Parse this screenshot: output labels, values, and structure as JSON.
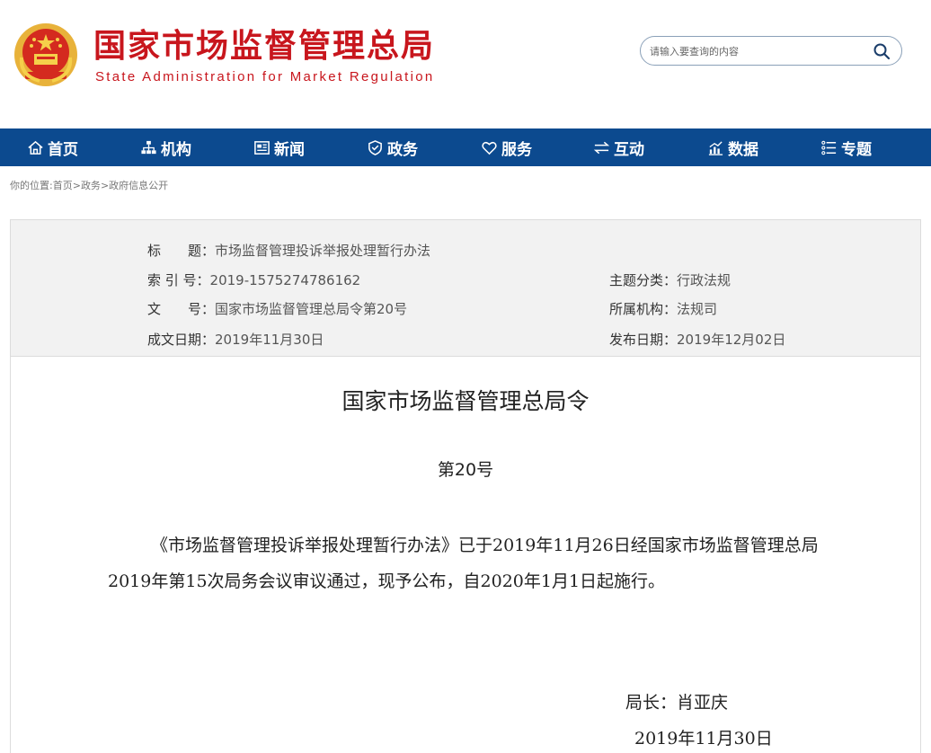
{
  "header": {
    "title_cn": "国家市场监督管理总局",
    "title_en": "State Administration for Market Regulation",
    "search_placeholder": "请输入要查询的内容"
  },
  "nav": {
    "items": [
      {
        "label": "首页",
        "icon": "home-icon"
      },
      {
        "label": "机构",
        "icon": "org-chart-icon"
      },
      {
        "label": "新闻",
        "icon": "newspaper-icon"
      },
      {
        "label": "政务",
        "icon": "shield-icon"
      },
      {
        "label": "服务",
        "icon": "heart-icon"
      },
      {
        "label": "互动",
        "icon": "exchange-icon"
      },
      {
        "label": "数据",
        "icon": "bar-chart-icon"
      },
      {
        "label": "专题",
        "icon": "list-icon"
      }
    ]
  },
  "breadcrumb": {
    "prefix": "你的位置:",
    "items": [
      "首页",
      "政务",
      "政府信息公开"
    ],
    "separator": ">"
  },
  "meta": {
    "title_label": "标　　题：",
    "title_value": "市场监督管理投诉举报处理暂行办法",
    "index_label": "索 引 号：",
    "index_value": "2019-1575274786162",
    "topic_label": "主题分类：",
    "topic_value": "行政法规",
    "docno_label": "文　　号：",
    "docno_value": "国家市场监督管理总局令第20号",
    "org_label": "所属机构：",
    "org_value": "法规司",
    "made_label": "成文日期：",
    "made_value": "2019年11月30日",
    "pub_label": "发布日期：",
    "pub_value": "2019年12月02日"
  },
  "document": {
    "title": "国家市场监督管理总局令",
    "number": "第20号",
    "body": "《市场监督管理投诉举报处理暂行办法》已于2019年11月26日经国家市场监督管理总局2019年第15次局务会议审议通过，现予公布，自2020年1月1日起施行。",
    "signer": "局长：肖亚庆",
    "date": "2019年11月30日"
  },
  "colors": {
    "brand_red": "#c8161d",
    "nav_blue": "#0c4a8f",
    "meta_bg": "#f2f2f2"
  }
}
